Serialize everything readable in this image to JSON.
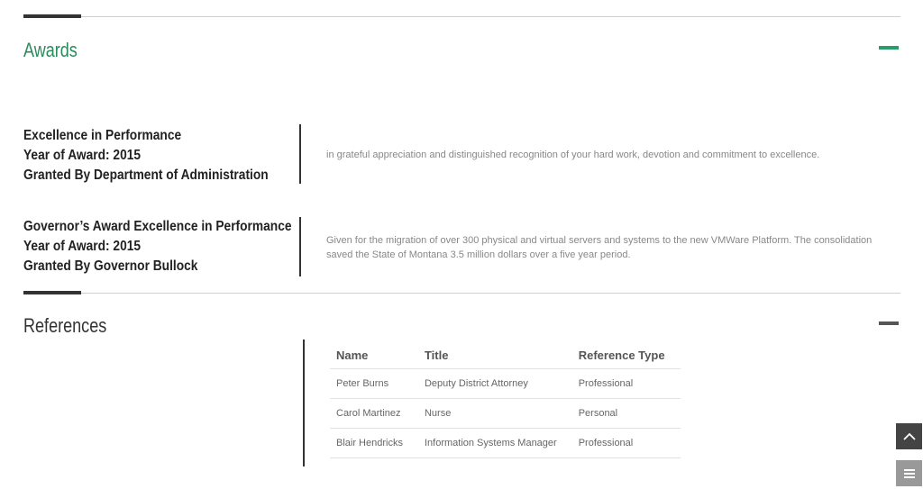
{
  "awards": {
    "title": "Awards",
    "items": [
      {
        "name": "Excellence in Performance",
        "year": "Year of Award: 2015",
        "granted_by": "Granted By Department of Administration",
        "description": "in grateful appreciation and distinguished recognition of your hard work, devotion and commitment to excellence."
      },
      {
        "name": "Governor’s Award Excellence in Performance",
        "year": "Year of Award: 2015",
        "granted_by": "Granted By Governor Bullock",
        "description": "Given for the migration of over 300 physical and virtual servers and systems to the new VMWare Platform. The consolidation saved the State of Montana 3.5 million dollars over a five year period."
      }
    ]
  },
  "references": {
    "title": "References",
    "headers": [
      "Name",
      "Title",
      "Reference Type"
    ],
    "rows": [
      [
        "Peter Burns",
        "Deputy District Attorney",
        "Professional"
      ],
      [
        "Carol Martinez",
        "Nurse",
        "Personal"
      ],
      [
        "Blair Hendricks",
        "Information Systems Manager",
        "Professional"
      ]
    ]
  },
  "icons": {
    "scroll_top": "chevron-up-icon",
    "menu": "menu-icon"
  },
  "colors": {
    "accent_green": "#2a8a5c",
    "dark": "#333333"
  }
}
